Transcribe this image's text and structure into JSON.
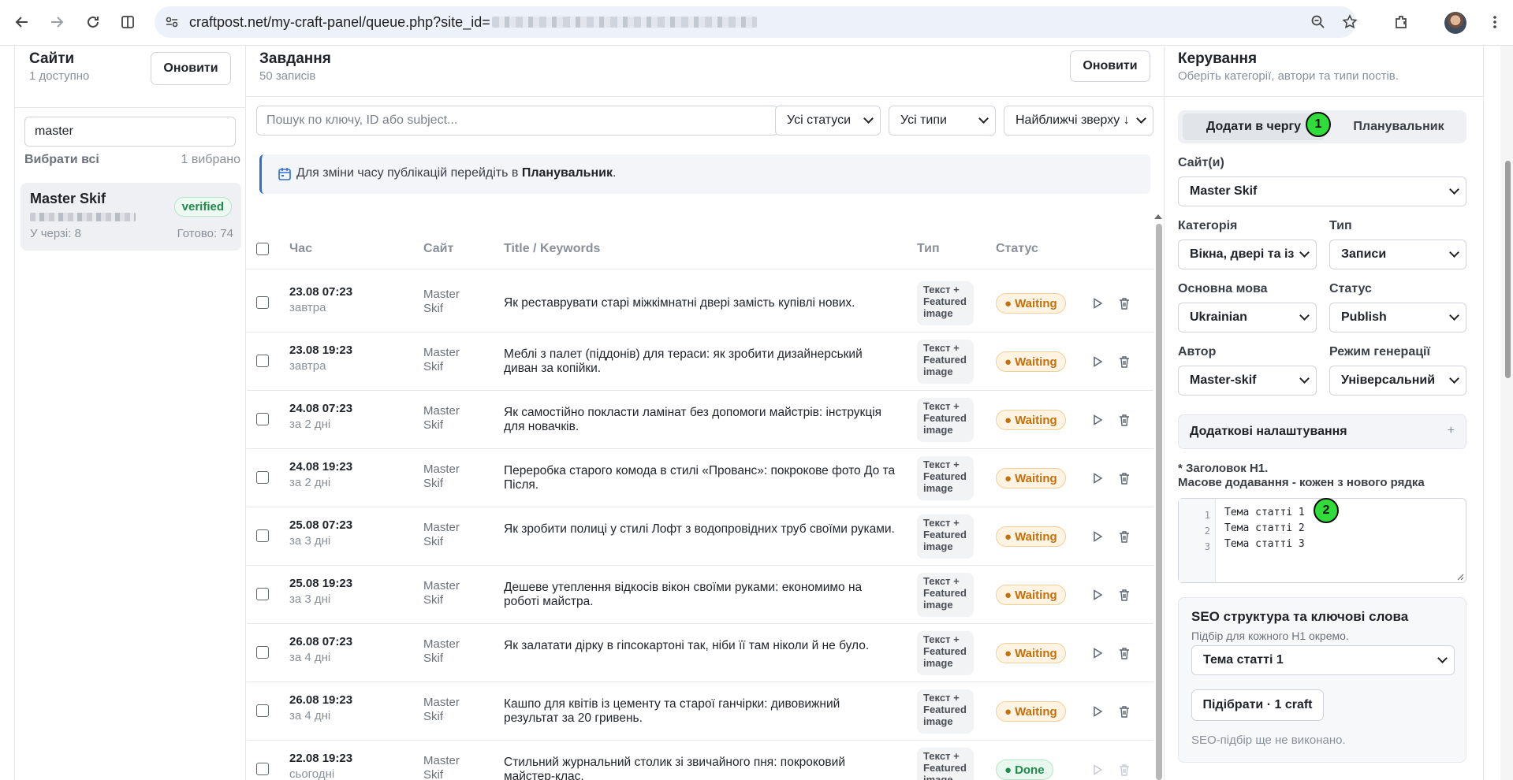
{
  "browser": {
    "url": "craftpost.net/my-craft-panel/queue.php?site_id="
  },
  "sites": {
    "title": "Сайти",
    "subtitle": "1 доступно",
    "refresh_label": "Оновити",
    "search_value": "master",
    "select_all_label": "Вибрати всі",
    "selected_count": "1 вибрано",
    "card": {
      "name": "Master Skif",
      "badge": "verified",
      "queue": "У черзі: 8",
      "ready": "Готово: 74"
    }
  },
  "tasks": {
    "title": "Завдання",
    "subtitle": "50 записів",
    "refresh_label": "Оновити",
    "search_placeholder": "Пошук по ключу, ID або subject...",
    "filter_status": "Усі статуси",
    "filter_type": "Усі типи",
    "sort": "Найближчі зверху ↓",
    "info_text": "Для зміни часу публікацій перейдіть в ",
    "info_link": "Планувальник",
    "info_end": ".",
    "columns": [
      "Час",
      "Сайт",
      "Title / Keywords",
      "Тип",
      "Статус"
    ],
    "rows": [
      {
        "time": "23.08 07:23",
        "rel": "завтра",
        "site1": "Master",
        "site2": "Skif",
        "title": "Як реставрувати старі міжкімнатні двері замість купівлі нових.",
        "type": [
          "Текст +",
          "Featured",
          "image"
        ],
        "status": "Waiting"
      },
      {
        "time": "23.08 19:23",
        "rel": "завтра",
        "site1": "Master",
        "site2": "Skif",
        "title": "Меблі з палет (піддонів) для тераси: як зробити дизайнерський диван за копійки.",
        "type": [
          "Текст +",
          "Featured",
          "image"
        ],
        "status": "Waiting"
      },
      {
        "time": "24.08 07:23",
        "rel": "за 2 дні",
        "site1": "Master",
        "site2": "Skif",
        "title": "Як самостійно покласти ламінат без допомоги майстрів: інструкція для новачків.",
        "type": [
          "Текст +",
          "Featured",
          "image"
        ],
        "status": "Waiting"
      },
      {
        "time": "24.08 19:23",
        "rel": "за 2 дні",
        "site1": "Master",
        "site2": "Skif",
        "title": "Переробка старого комода в стилі «Прованс»: покрокове фото До та Після.",
        "type": [
          "Текст +",
          "Featured",
          "image"
        ],
        "status": "Waiting"
      },
      {
        "time": "25.08 07:23",
        "rel": "за 3 дні",
        "site1": "Master",
        "site2": "Skif",
        "title": "Як зробити полиці у стилі Лофт з водопровідних труб своїми руками.",
        "type": [
          "Текст +",
          "Featured",
          "image"
        ],
        "status": "Waiting"
      },
      {
        "time": "25.08 19:23",
        "rel": "за 3 дні",
        "site1": "Master",
        "site2": "Skif",
        "title": "Дешеве утеплення відкосів вікон своїми руками: економимо на роботі майстра.",
        "type": [
          "Текст +",
          "Featured",
          "image"
        ],
        "status": "Waiting"
      },
      {
        "time": "26.08 07:23",
        "rel": "за 4 дні",
        "site1": "Master",
        "site2": "Skif",
        "title": "Як залатати дірку в гіпсокартоні так, ніби її там ніколи й не було.",
        "type": [
          "Текст +",
          "Featured",
          "image"
        ],
        "status": "Waiting"
      },
      {
        "time": "26.08 19:23",
        "rel": "за 4 дні",
        "site1": "Master",
        "site2": "Skif",
        "title": "Кашпо для квітів із цементу та старої ганчірки: дивовижний результат за 20 гривень.",
        "type": [
          "Текст +",
          "Featured",
          "image"
        ],
        "status": "Waiting"
      },
      {
        "time": "22.08 19:23",
        "rel": "сьогодні",
        "site1": "Master",
        "site2": "Skif",
        "title": "Стильний журнальний столик зі звичайного пня: покроковий майстер-клас.",
        "type": [
          "Текст +",
          "Featured",
          "image"
        ],
        "status": "Done"
      }
    ]
  },
  "control": {
    "title": "Керування",
    "subtitle": "Оберіть категорії, автори та типи постів.",
    "tab_queue": "Додати в чергу",
    "tab_planner": "Планувальник",
    "marker1": "1",
    "marker2": "2",
    "sites_label": "Сайт(и)",
    "sites_value": "Master Skif",
    "category_label": "Категорія",
    "category_value": "Вікна, двері та із",
    "type_label": "Тип",
    "type_value": "Записи",
    "lang_label": "Основна мова",
    "lang_value": "Ukrainian",
    "status_label": "Статус",
    "status_value": "Publish",
    "author_label": "Автор",
    "author_value": "Master-skif",
    "mode_label": "Режим генерації",
    "mode_value": "Універсальний",
    "extra_label": "Додаткові налаштування",
    "extra_plus": "+",
    "h1_label": "* Заголовок H1.",
    "h1_sub": "Масове додавання - кожен з нового рядка",
    "h1_lines": [
      "Тема статті 1",
      "Тема статті 2",
      "Тема статті 3"
    ],
    "h1_numbers": [
      "1",
      "2",
      "3"
    ],
    "seo_title": "SEO структура та ключові слова",
    "seo_sub": "Підбір для кожного H1 окремо.",
    "seo_select": "Тема статті 1",
    "seo_button": "Підібрати · 1 craft",
    "seo_note": "SEO-підбір ще не виконано."
  },
  "colors": {
    "accent_blue": "#2f6fd0",
    "waiting": "#c2700c",
    "done": "#1f8a4c",
    "marker_green": "#2fdc3a"
  }
}
